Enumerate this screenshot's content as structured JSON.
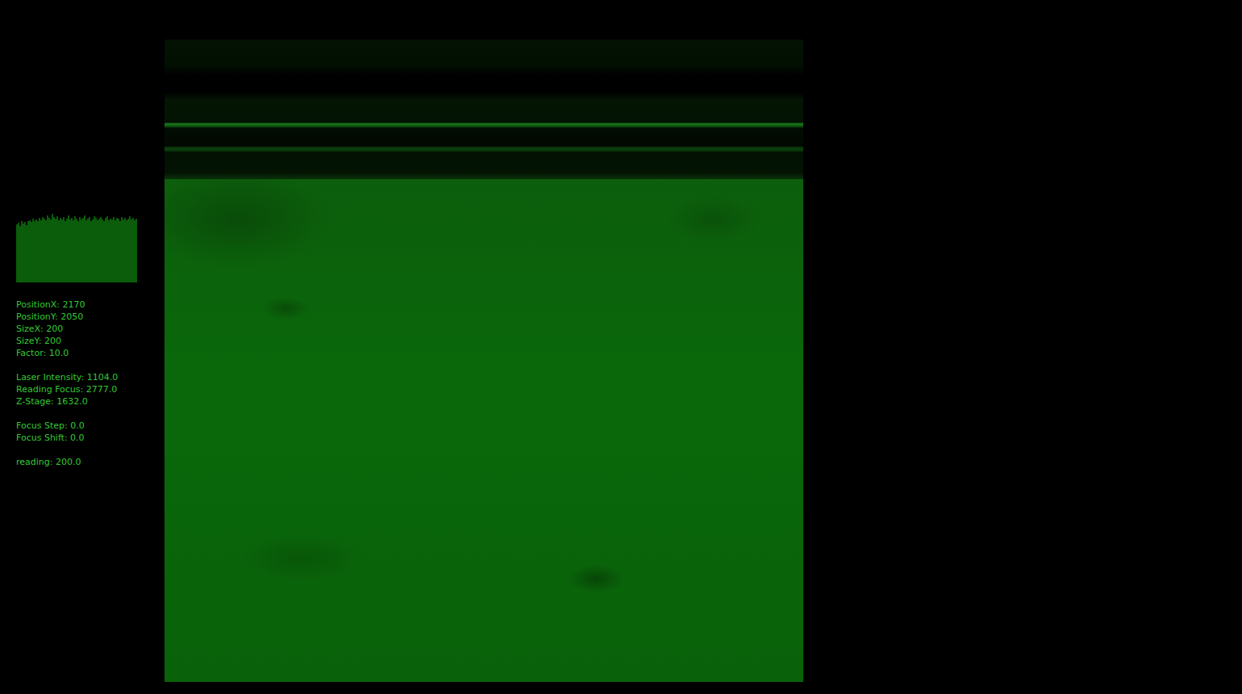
{
  "histogram": {
    "values": [
      80,
      82,
      78,
      84,
      81,
      83,
      79,
      85,
      86,
      83,
      88,
      84,
      87,
      85,
      89,
      86,
      90,
      88,
      86,
      92,
      89,
      87,
      95,
      90,
      88,
      91,
      86,
      89,
      87,
      90,
      85,
      88,
      92,
      87,
      89,
      86,
      91,
      88,
      85,
      90,
      87,
      89,
      92,
      86,
      88,
      90,
      85,
      87,
      91,
      89,
      86,
      88,
      90,
      87,
      85,
      89,
      91,
      86,
      88,
      87,
      90,
      86,
      89,
      88,
      85,
      90,
      87,
      89,
      86,
      88,
      91,
      87,
      89,
      86,
      88
    ]
  },
  "info_groups": [
    {
      "lines": [
        "PositionX: 2170",
        "PositionY: 2050",
        "SizeX: 200",
        "SizeY: 200",
        "Factor: 10.0"
      ]
    },
    {
      "lines": [
        "Laser Intensity: 1104.0",
        "Reading Focus: 2777.0",
        "Z-Stage: 1632.0"
      ]
    },
    {
      "lines": [
        "Focus Step: 0.0",
        "Focus Shift: 0.0"
      ]
    },
    {
      "lines": [
        "reading: 200.0"
      ]
    }
  ]
}
